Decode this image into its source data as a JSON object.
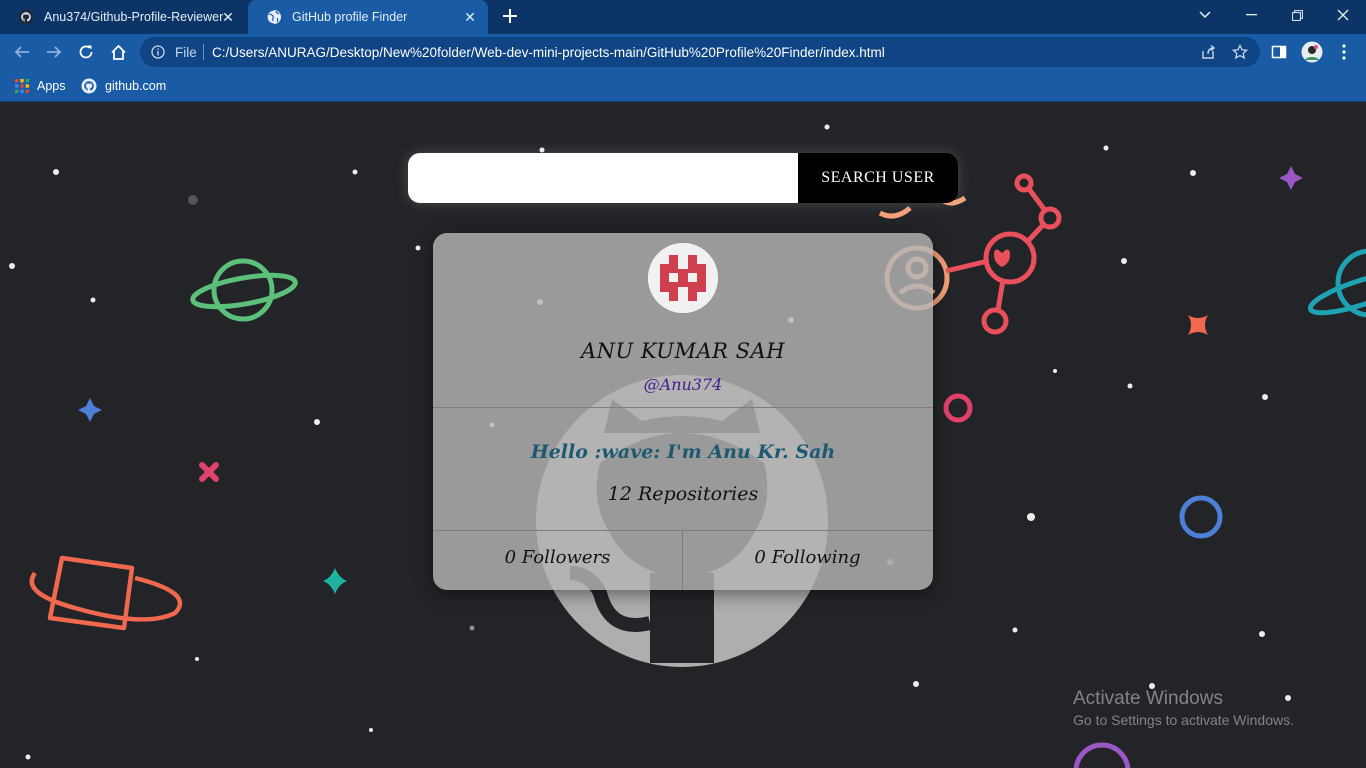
{
  "browser": {
    "tabs": [
      {
        "title": "Anu374/Github-Profile-Reviewer",
        "active": false,
        "icon": "github-icon"
      },
      {
        "title": "GitHub profile Finder",
        "active": true,
        "icon": "globe-icon"
      }
    ],
    "address": {
      "scheme_label": "File",
      "url": "C:/Users/ANURAG/Desktop/New%20folder/Web-dev-mini-projects-main/GitHub%20Profile%20Finder/index.html"
    },
    "bookmarks": [
      {
        "label": "Apps",
        "icon": "apps-grid-icon"
      },
      {
        "label": "github.com",
        "icon": "github-icon"
      }
    ],
    "colors": {
      "tabbar": "#0c3466",
      "toolbar": "#1a5ba6"
    }
  },
  "search": {
    "input_value": "",
    "button_label": "SEARCH USER"
  },
  "profile": {
    "name": "ANU KUMAR SAH",
    "login": "@Anu374",
    "bio": "Hello :wave: I'm Anu Kr. Sah",
    "repos_text": "12 Repositories",
    "followers_text": "0 Followers",
    "following_text": "0 Following"
  },
  "watermark": {
    "line1": "Activate Windows",
    "line2": "Go to Settings to activate Windows."
  }
}
